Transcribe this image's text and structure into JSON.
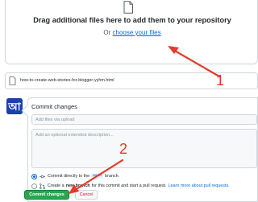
{
  "upload": {
    "title": "Drag additional files here to add them to your repository",
    "choose_prefix": "Or ",
    "choose_link": "choose your files",
    "icon": "file-icon"
  },
  "file_row": {
    "name": "how-to-create-web-stories-for-blogger-yyhm.html",
    "icon": "file-icon"
  },
  "avatar": {
    "glyph": "আ",
    "color": "#1d3fb0"
  },
  "commit": {
    "title": "Commit changes",
    "summary_placeholder": "Add files via upload",
    "description_placeholder": "Add an optional extended description...",
    "option_direct_prefix": "Commit directly to the",
    "branch_name": "main",
    "option_direct_suffix": "branch.",
    "option_new_prefix": "Create a",
    "option_new_bold": "new branch",
    "option_new_suffix": "for this commit and start a pull request.",
    "learn_more": "Learn more about pull requests.",
    "commit_button": "Commit changes",
    "cancel_button": "Cancel"
  },
  "annotations": {
    "step_1": "1",
    "step_2": "2",
    "color": "#e53a2a"
  },
  "colors": {
    "commit_button": "#2da44e",
    "link": "#0969da",
    "cancel_text": "#cf222e"
  }
}
